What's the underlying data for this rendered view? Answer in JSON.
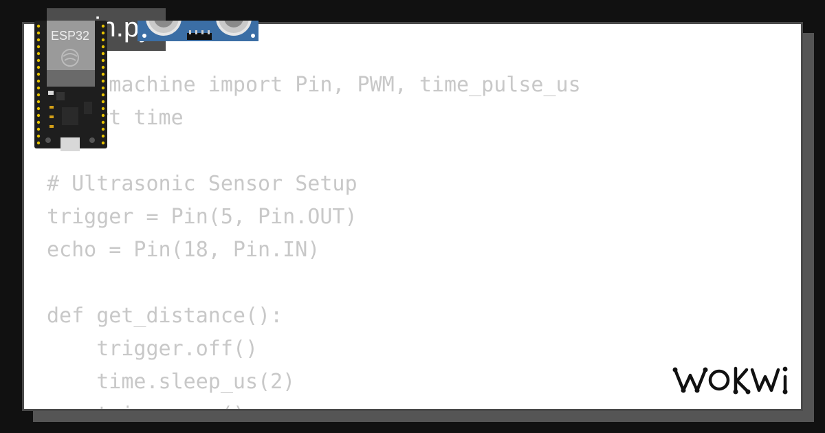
{
  "editor": {
    "tab_label": "main.py",
    "code_lines": [
      "from machine import Pin, PWM, time_pulse_us",
      "import time",
      "",
      "# Ultrasonic Sensor Setup",
      "trigger = Pin(5, Pin.OUT)",
      "echo = Pin(18, Pin.IN)",
      "",
      "def get_distance():",
      "    trigger.off()",
      "    time.sleep_us(2)",
      "    trigger.on()"
    ]
  },
  "esp_board": {
    "label": "ESP32"
  },
  "logo": {
    "text": "WOKWi"
  },
  "colors": {
    "background": "#111111",
    "card": "#ffffff",
    "code_text": "#c8c8c8",
    "tab": "#4d4d4d",
    "sensor_blue": "#3b6ea5",
    "board": "#1e1e1e"
  }
}
